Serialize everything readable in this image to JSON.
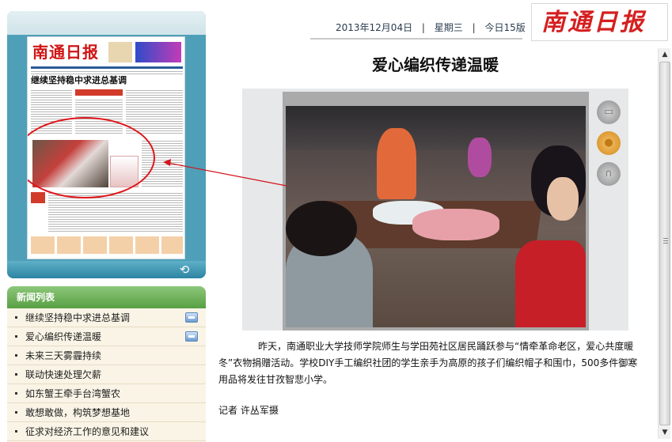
{
  "header": {
    "date": "2013年12月04日",
    "weekday": "星期三",
    "edition": "今日15版",
    "separator": "|",
    "logo_text": "南通日报"
  },
  "thumbnail": {
    "masthead": "南通日报",
    "headline": "继续坚持稳中求进总基调",
    "refresh_icon": "refresh-icon"
  },
  "news_list": {
    "title": "新闻列表",
    "items": [
      {
        "label": "继续坚持稳中求进总基调",
        "has_media": true
      },
      {
        "label": "爱心编织传递温暖",
        "has_media": true
      },
      {
        "label": "未来三天雾霾持续",
        "has_media": false
      },
      {
        "label": "联动快速处理欠薪",
        "has_media": false
      },
      {
        "label": "如东蟹王牵手台湾蟹农",
        "has_media": false
      },
      {
        "label": "敢想敢做，构筑梦想基地",
        "has_media": false
      },
      {
        "label": "征求对经济工作的意见和建议",
        "has_media": false
      }
    ]
  },
  "article": {
    "title": "爱心编织传递温暖",
    "body": "昨天，南通职业大学技师学院师生与学田苑社区居民踊跃参与“情牵革命老区，爱心共度暖冬”衣物捐赠活动。学校DIY手工编织社团的学生亲手为高原的孩子们编织帽子和围巾，500多件御寒用品将发往甘孜智悲小学。",
    "byline": "记者  许丛军摄"
  },
  "side_buttons": {
    "video_icon": "video-icon",
    "photo_icon": "person-photo-icon",
    "audio_icon": "headphones-icon"
  },
  "colors": {
    "brand_red": "#d51f1f",
    "panel_teal": "#4f9fb8",
    "list_green": "#58a043",
    "list_bg": "#f9f4e6"
  }
}
